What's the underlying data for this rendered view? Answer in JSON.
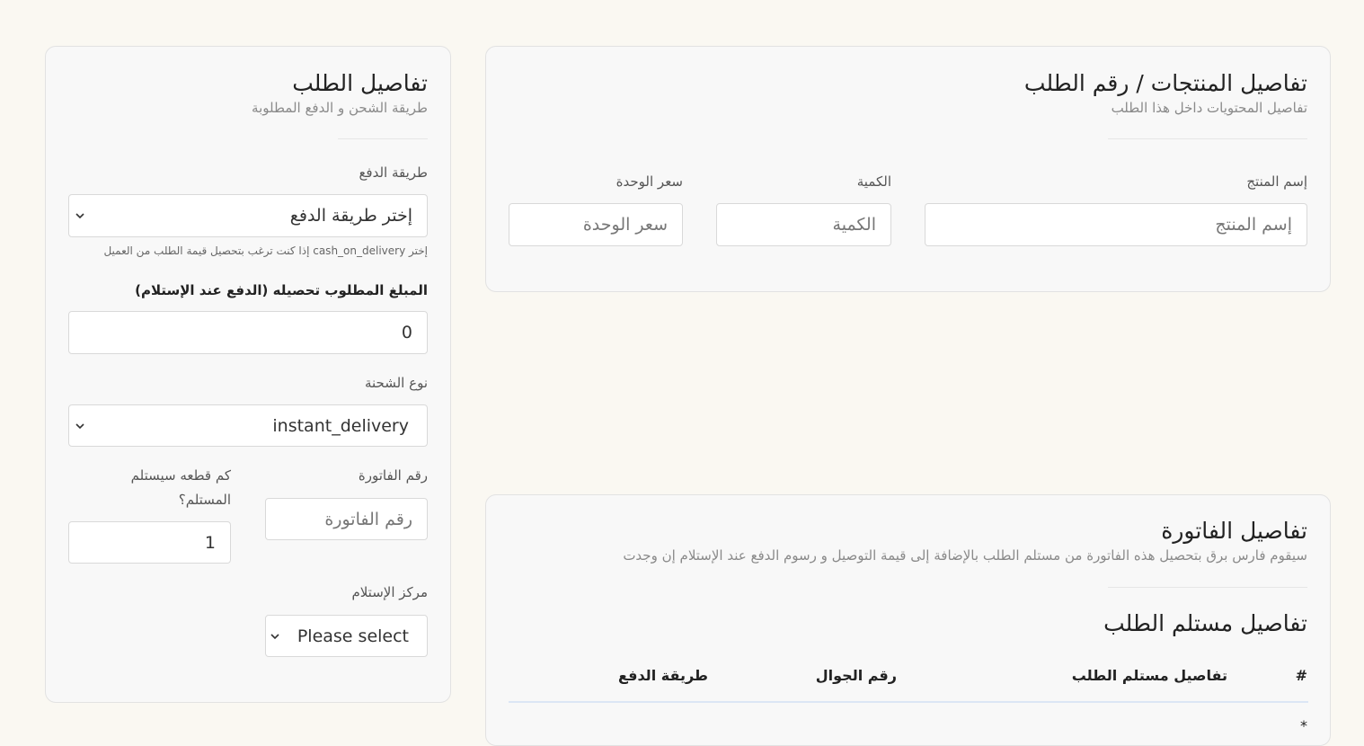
{
  "order_details": {
    "title": "تفاصيل الطلب",
    "subtitle": "طريقة الشحن و الدفع المطلوبة",
    "payment_method": {
      "label": "طريقة الدفع",
      "value": "إختر طريقة الدفع",
      "hint": "إختر cash_on_delivery إذا كنت ترغب بتحصيل قيمة الطلب من العميل"
    },
    "cod_amount": {
      "label": "المبلغ المطلوب تحصيله (الدفع عند الإستلام)",
      "value": "0"
    },
    "shipment_type": {
      "label": "نوع الشحنة",
      "value": "instant_delivery"
    },
    "invoice_number": {
      "label": "رقم الفاتورة",
      "placeholder": "رقم الفاتورة"
    },
    "pieces": {
      "label_line1": "كم قطعه سيستلم",
      "label_line2": "المستلم؟",
      "value": "1"
    },
    "pickup_center": {
      "label": "مركز الإستلام",
      "value": "Please select"
    }
  },
  "products": {
    "title": "تفاصيل المنتجات / رقم الطلب",
    "subtitle": "تفاصيل المحتويات داخل هذا الطلب",
    "product_name": {
      "label": "إسم المنتج",
      "placeholder": "إسم المنتج"
    },
    "quantity": {
      "label": "الكمية",
      "placeholder": "الكمية"
    },
    "unit_price": {
      "label": "سعر الوحدة",
      "placeholder": "سعر الوحدة"
    }
  },
  "invoice": {
    "title": "تفاصيل الفاتورة",
    "subtitle": "سيقوم فارس برق بتحصيل هذه الفاتورة من مستلم الطلب بالإضافة إلى قيمة التوصيل و رسوم الدفع عند الإستلام إن وجدت",
    "recipient_title": "تفاصيل مستلم الطلب",
    "table_headers": [
      "#",
      "تفاصيل مستلم الطلب",
      "رقم الجوال",
      "طريقة الدفع"
    ],
    "first_row_marker": "*"
  },
  "icons": {
    "chevron": "chevron-down-icon"
  }
}
